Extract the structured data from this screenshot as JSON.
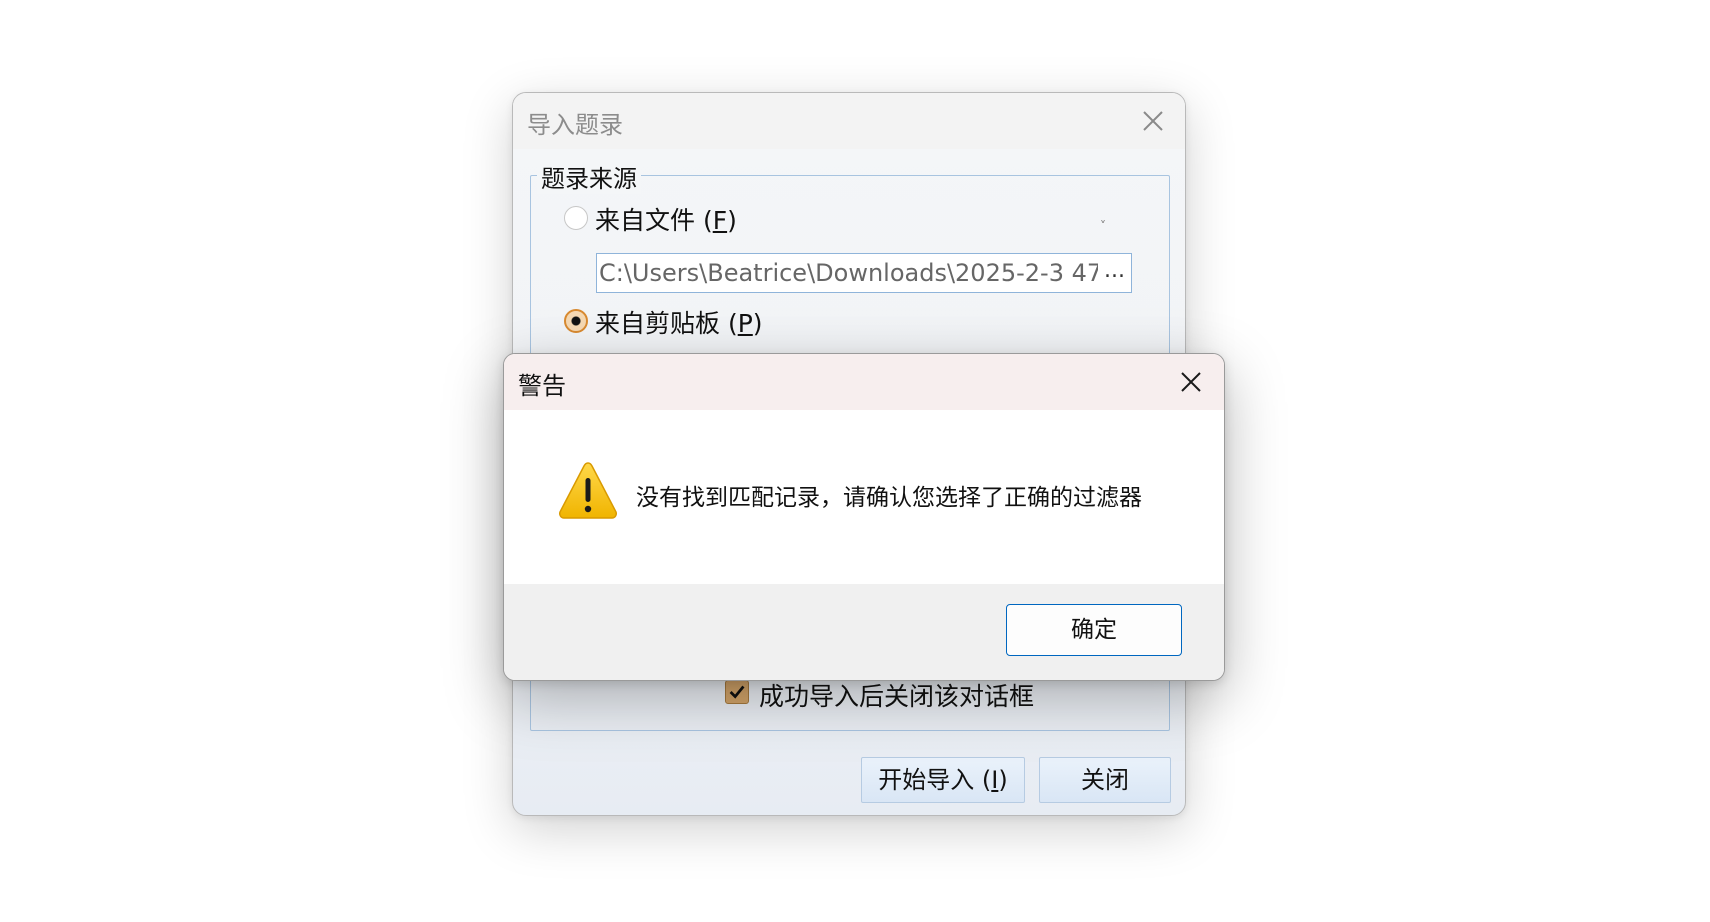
{
  "import_dialog": {
    "title": "导入题录",
    "close_icon": "close-icon",
    "group_label": "题录来源",
    "from_file": {
      "label_prefix": "来自文件 (",
      "accelerator": "F",
      "label_suffix": ")",
      "selected": false
    },
    "dropdown_mark": "˅",
    "file_path": "C:\\Users\\Beatrice\\Downloads\\2025-2-3 47(",
    "browse_label": "...",
    "from_clipboard": {
      "label_prefix": "来自剪贴板 (",
      "accelerator": "P",
      "label_suffix": ")",
      "selected": true
    },
    "close_after_import": {
      "label": "成功导入后关闭该对话框",
      "checked": true
    },
    "start_button": {
      "label_prefix": "开始导入 (",
      "accelerator": "I",
      "label_suffix": ")"
    },
    "close_button_label": "关闭"
  },
  "warning_dialog": {
    "title": "警告",
    "close_icon": "close-icon",
    "icon": "warning-icon",
    "message": "没有找到匹配记录，请确认您选择了正确的过滤器",
    "ok_label": "确定"
  },
  "colors": {
    "accent_orange": "#d98a30",
    "ok_border": "#0067c0",
    "warning_yellow": "#f5c400"
  }
}
